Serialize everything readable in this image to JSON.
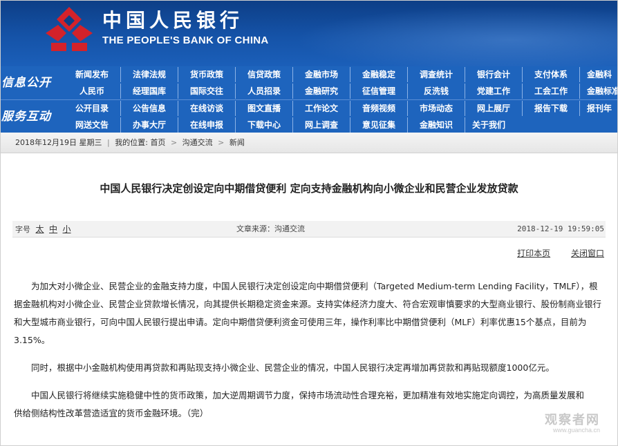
{
  "header": {
    "logo_cn": "中国人民银行",
    "logo_en": "THE PEOPLE'S BANK OF CHINA",
    "logo_icon": "pboc-emblem-icon",
    "brand_color": "#0d3e86",
    "logo_color": "#d3222a"
  },
  "nav": {
    "section1_label": "信息公开",
    "section2_label": "服务互动",
    "section1_rows": [
      [
        "新闻发布",
        "法律法规",
        "货币政策",
        "信贷政策",
        "金融市场",
        "金融稳定",
        "调查统计",
        "银行会计",
        "支付体系",
        "金融科"
      ],
      [
        "人民币",
        "经理国库",
        "国际交往",
        "人员招录",
        "金融研究",
        "征信管理",
        "反洗钱",
        "党建工作",
        "工会工作",
        "金融标准"
      ]
    ],
    "section2_rows": [
      [
        "公开目录",
        "公告信息",
        "在线访谈",
        "图文直播",
        "工作论文",
        "音频视频",
        "市场动态",
        "网上展厅",
        "报告下载",
        "报刊年"
      ],
      [
        "网送文告",
        "办事大厅",
        "在线申报",
        "下载中心",
        "网上调查",
        "意见征集",
        "金融知识",
        "关于我们"
      ]
    ],
    "nav_color": "#1e64bd"
  },
  "breadcrumb": {
    "date": "2018年12月19日 星期三",
    "location_label": "我的位置:",
    "home": "首页",
    "level1": "沟通交流",
    "level2": "新闻"
  },
  "article": {
    "title": "中国人民银行决定创设定向中期借贷便利 定向支持金融机构向小微企业和民营企业发放贷款",
    "font_size_label": "字号",
    "font_sizes": [
      "太",
      "中",
      "小"
    ],
    "source": "文章来源：沟通交流",
    "date": "2018-12-19 19:59:05",
    "print_label": "打印本页",
    "close_label": "关闭窗口",
    "paragraphs": [
      "为加大对小微企业、民营企业的金融支持力度，中国人民银行决定创设定向中期借贷便利（Targeted Medium-term Lending Facility，TMLF），根据金融机构对小微企业、民营企业贷款增长情况，向其提供长期稳定资金来源。支持实体经济力度大、符合宏观审慎要求的大型商业银行、股份制商业银行和大型城市商业银行，可向中国人民银行提出申请。定向中期借贷便利资金可使用三年，操作利率比中期借贷便利（MLF）利率优惠15个基点，目前为3.15%。",
      "同时，根据中小金融机构使用再贷款和再贴现支持小微企业、民营企业的情况，中国人民银行决定再增加再贷款和再贴现额度1000亿元。",
      "中国人民银行将继续实施稳健中性的货币政策，加大逆周期调节力度，保持市场流动性合理充裕，更加精准有效地实施定向调控，为高质量发展和供给侧结构性改革营造适宜的货币金融环境。（完）"
    ]
  },
  "watermark": {
    "cn": "观察者网",
    "url": "www.guancha.cn"
  }
}
